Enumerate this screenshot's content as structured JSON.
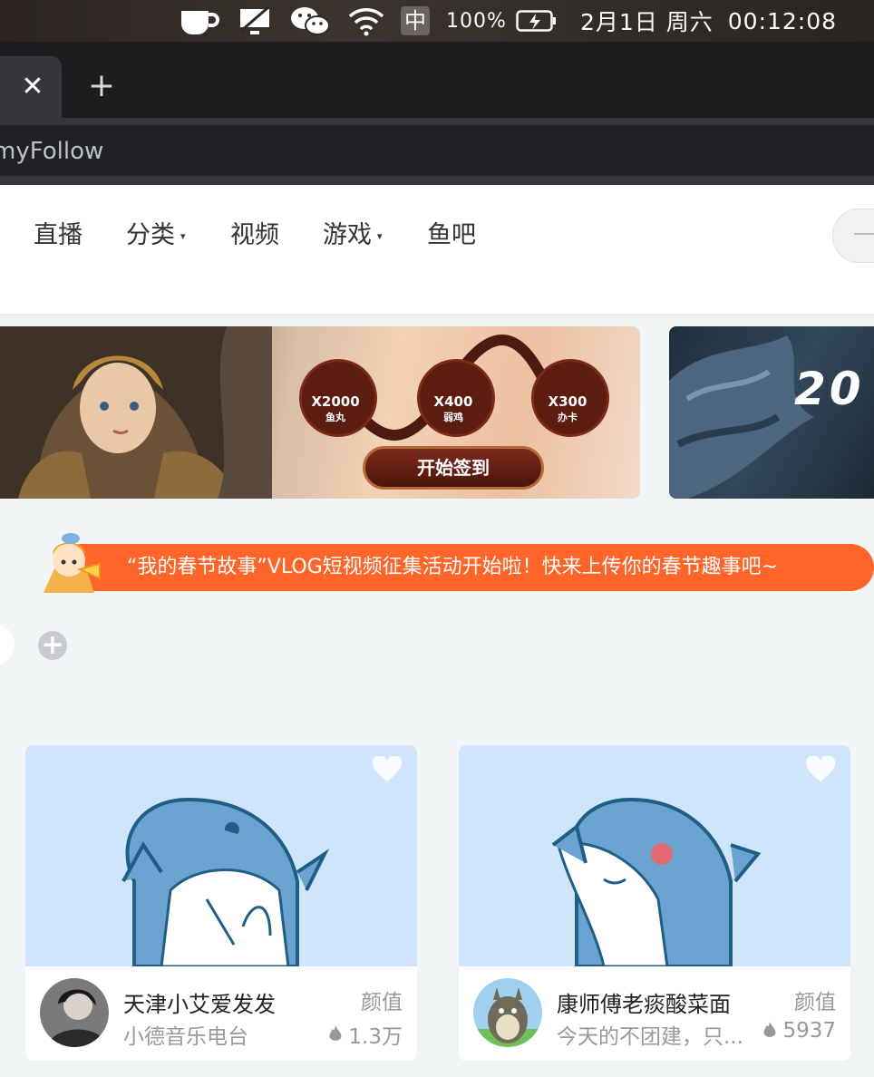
{
  "menubar": {
    "battery": "100%",
    "input_method": "中",
    "date": "2月1日 周六",
    "time": "00:12:08"
  },
  "browser": {
    "close_tab": "✕",
    "new_tab": "+",
    "url": "myFollow"
  },
  "nav": {
    "items": [
      {
        "label": "直播",
        "has_dropdown": false
      },
      {
        "label": "分类",
        "has_dropdown": true
      },
      {
        "label": "视频",
        "has_dropdown": false
      },
      {
        "label": "游戏",
        "has_dropdown": true
      },
      {
        "label": "鱼吧",
        "has_dropdown": false
      }
    ],
    "caret": "▾"
  },
  "banners": {
    "main": {
      "rewards": [
        {
          "qty": "X2000",
          "name": "鱼丸"
        },
        {
          "qty": "X400",
          "name": "弱鸡"
        },
        {
          "qty": "X300",
          "name": "办卡"
        }
      ],
      "button": "开始签到"
    },
    "second": {
      "text": "20"
    }
  },
  "notice": {
    "text": "“我的春节故事”VLOG短视频征集活动开始啦！快来上传你的春节趣事吧~",
    "color": "#ff6428"
  },
  "filter": {
    "add_label": "+"
  },
  "cards": [
    {
      "title": "天津小艾爱发发",
      "category": "颜值",
      "subtitle": "小德音乐电台",
      "hot": "1.3万"
    },
    {
      "title": "康师傅老痰酸菜面",
      "category": "颜值",
      "subtitle": "今天的不团建，只...",
      "hot": "5937"
    }
  ]
}
